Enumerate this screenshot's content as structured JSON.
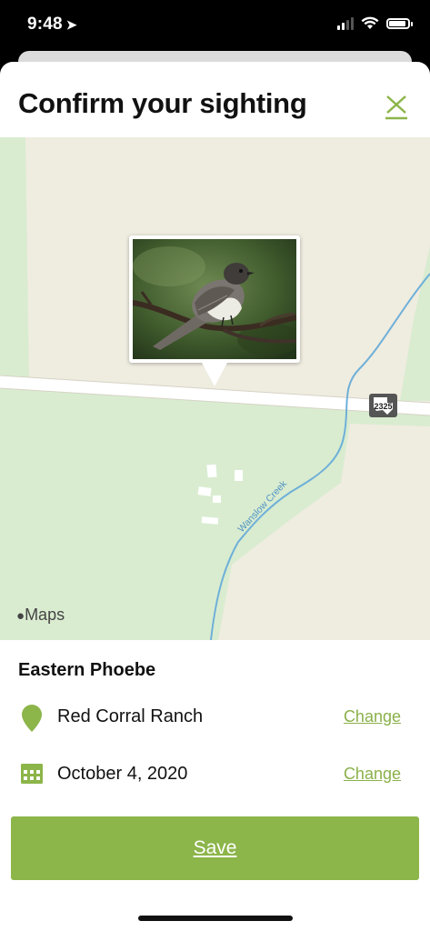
{
  "status_bar": {
    "time": "9:48"
  },
  "header": {
    "title": "Confirm your sighting"
  },
  "map": {
    "attribution": "Maps",
    "creek_label": "Wanslow Creek",
    "road_shield": "2325"
  },
  "sighting": {
    "species": "Eastern Phoebe",
    "location": "Red Corral Ranch",
    "location_change": "Change",
    "date": "October 4, 2020",
    "date_change": "Change"
  },
  "actions": {
    "save_label": "Save"
  },
  "colors": {
    "accent": "#8cb54a",
    "map_green": "#d9ecd0",
    "map_land": "#efece0",
    "creek": "#6fb0d8"
  }
}
